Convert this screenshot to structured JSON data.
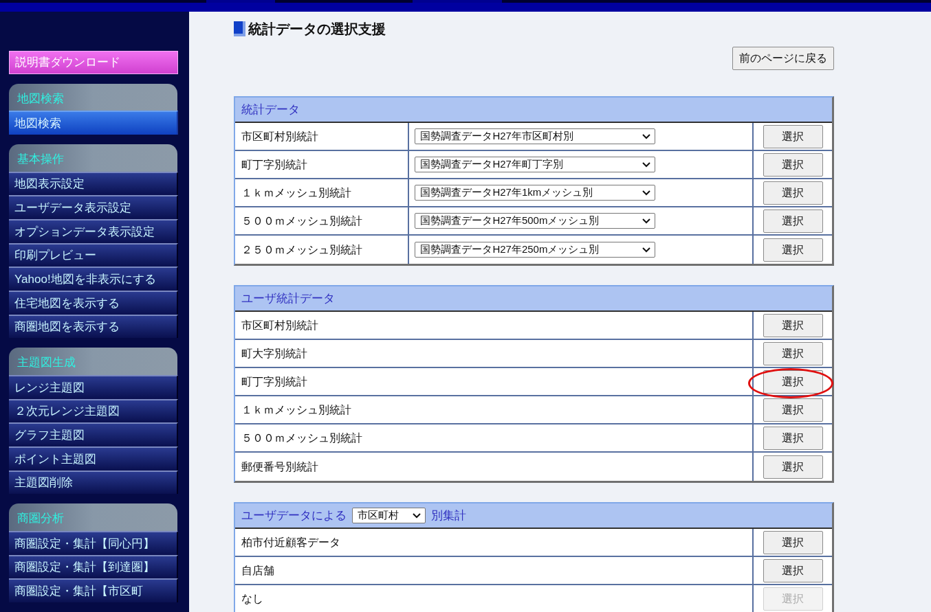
{
  "sidebar": {
    "download_button": "説明書ダウンロード",
    "sections": [
      {
        "title": "地図検索",
        "items": [
          {
            "label": "地図検索",
            "selected": true
          }
        ]
      },
      {
        "title": "基本操作",
        "items": [
          {
            "label": "地図表示設定",
            "selected": false
          },
          {
            "label": "ユーザデータ表示設定",
            "selected": false
          },
          {
            "label": "オプションデータ表示設定",
            "selected": false
          },
          {
            "label": "印刷プレビュー",
            "selected": false
          },
          {
            "label": "Yahoo!地図を非表示にする",
            "selected": false
          },
          {
            "label": "住宅地図を表示する",
            "selected": false
          },
          {
            "label": "商圏地図を表示する",
            "selected": false
          }
        ]
      },
      {
        "title": "主題図生成",
        "items": [
          {
            "label": "レンジ主題図",
            "selected": false
          },
          {
            "label": "２次元レンジ主題図",
            "selected": false
          },
          {
            "label": "グラフ主題図",
            "selected": false
          },
          {
            "label": "ポイント主題図",
            "selected": false
          },
          {
            "label": "主題図削除",
            "selected": false
          }
        ]
      },
      {
        "title": "商圏分析",
        "items": [
          {
            "label": "商圏設定・集計【同心円】",
            "selected": false
          },
          {
            "label": "商圏設定・集計【到達圏】",
            "selected": false
          },
          {
            "label": "商圏設定・集計【市区町",
            "selected": false
          }
        ]
      }
    ]
  },
  "main": {
    "title": "統計データの選択支援",
    "back_button": "前のページに戻る",
    "stat_table": {
      "title": "統計データ",
      "rows": [
        {
          "label": "市区町村別統計",
          "select_value": "国勢調査データH27年市区町村別",
          "button": "選択"
        },
        {
          "label": "町丁字別統計",
          "select_value": "国勢調査データH27年町丁字別",
          "button": "選択"
        },
        {
          "label": "１ｋｍメッシュ別統計",
          "select_value": "国勢調査データH27年1kmメッシュ別",
          "button": "選択"
        },
        {
          "label": "５００ｍメッシュ別統計",
          "select_value": "国勢調査データH27年500mメッシュ別",
          "button": "選択"
        },
        {
          "label": "２５０ｍメッシュ別統計",
          "select_value": "国勢調査データH27年250mメッシュ別",
          "button": "選択"
        }
      ]
    },
    "user_stat_table": {
      "title": "ユーザ統計データ",
      "rows": [
        {
          "label": "市区町村別統計",
          "button": "選択",
          "circled": false
        },
        {
          "label": "町大字別統計",
          "button": "選択",
          "circled": false
        },
        {
          "label": "町丁字別統計",
          "button": "選択",
          "circled": true
        },
        {
          "label": "１ｋｍメッシュ別統計",
          "button": "選択",
          "circled": false
        },
        {
          "label": "５００ｍメッシュ別統計",
          "button": "選択",
          "circled": false
        },
        {
          "label": "郵便番号別統計",
          "button": "選択",
          "circled": false
        }
      ]
    },
    "user_data_table": {
      "title_prefix": "ユーザデータによる",
      "select_value": "市区町村",
      "title_suffix": "別集計",
      "rows": [
        {
          "label": "柏市付近顧客データ",
          "button": "選択",
          "disabled": false
        },
        {
          "label": "自店舗",
          "button": "選択",
          "disabled": false
        },
        {
          "label": "なし",
          "button": "選択",
          "disabled": true
        }
      ]
    }
  }
}
